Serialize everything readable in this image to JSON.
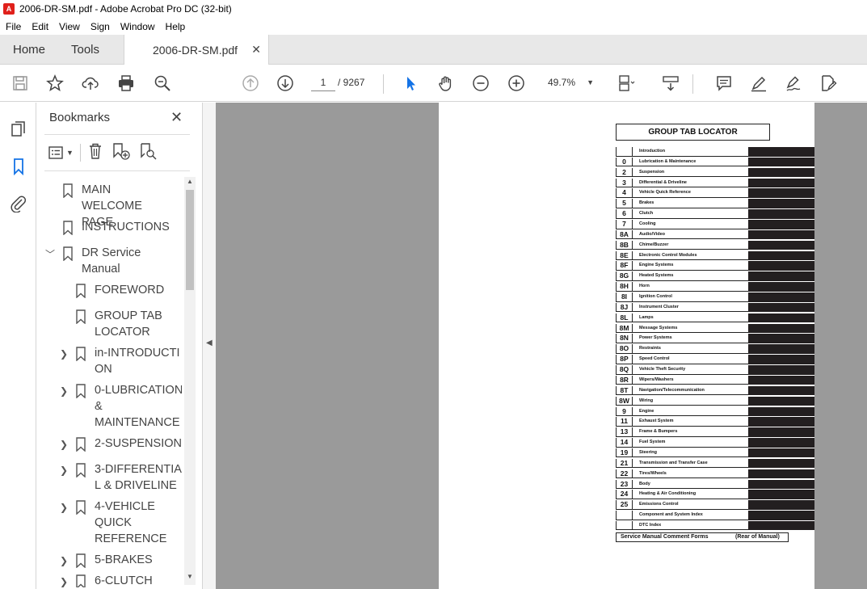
{
  "window": {
    "title": "2006-DR-SM.pdf - Adobe Acrobat Pro DC (32-bit)"
  },
  "menu": [
    "File",
    "Edit",
    "View",
    "Sign",
    "Window",
    "Help"
  ],
  "tabs": {
    "home": "Home",
    "tools": "Tools",
    "document": "2006-DR-SM.pdf"
  },
  "toolbar": {
    "page_current": "1",
    "page_total": "/ 9267",
    "zoom": "49.7%"
  },
  "bookmarks": {
    "header": "Bookmarks",
    "items": [
      {
        "label": "MAIN WELCOME\nPAGE",
        "level": 0,
        "expander": ""
      },
      {
        "label": "INSTRUCTIONS",
        "level": 0,
        "expander": ""
      },
      {
        "label": "DR Service\nManual",
        "level": 0,
        "expander": "down"
      },
      {
        "label": "FOREWORD",
        "level": 1,
        "expander": ""
      },
      {
        "label": "GROUP TAB\nLOCATOR",
        "level": 1,
        "expander": ""
      },
      {
        "label": "in-INTRODUCTI\nON",
        "level": 1,
        "expander": "right"
      },
      {
        "label": "0-LUBRICATION\n&\nMAINTENANCE",
        "level": 1,
        "expander": "right"
      },
      {
        "label": "2-SUSPENSION",
        "level": 1,
        "expander": "right"
      },
      {
        "label": "3-DIFFERENTIA\nL & DRIVELINE",
        "level": 1,
        "expander": "right"
      },
      {
        "label": "4-VEHICLE\nQUICK\nREFERENCE",
        "level": 1,
        "expander": "right"
      },
      {
        "label": "5-BRAKES",
        "level": 1,
        "expander": "right"
      },
      {
        "label": "6-CLUTCH",
        "level": 1,
        "expander": "right"
      }
    ]
  },
  "document": {
    "title": "GROUP TAB LOCATOR",
    "rows": [
      {
        "code": "",
        "name": "Introduction"
      },
      {
        "code": "0",
        "name": "Lubrication & Maintenance"
      },
      {
        "code": "2",
        "name": "Suspension"
      },
      {
        "code": "3",
        "name": "Differential & Driveline"
      },
      {
        "code": "4",
        "name": "Vehicle Quick Reference"
      },
      {
        "code": "5",
        "name": "Brakes"
      },
      {
        "code": "6",
        "name": "Clutch"
      },
      {
        "code": "7",
        "name": "Cooling"
      },
      {
        "code": "8A",
        "name": "Audio/Video"
      },
      {
        "code": "8B",
        "name": "Chime/Buzzer"
      },
      {
        "code": "8E",
        "name": "Electronic Control Modules"
      },
      {
        "code": "8F",
        "name": "Engine Systems"
      },
      {
        "code": "8G",
        "name": "Heated Systems"
      },
      {
        "code": "8H",
        "name": "Horn"
      },
      {
        "code": "8I",
        "name": "Ignition Control"
      },
      {
        "code": "8J",
        "name": "Instrument Cluster"
      },
      {
        "code": "8L",
        "name": "Lamps"
      },
      {
        "code": "8M",
        "name": "Message Systems"
      },
      {
        "code": "8N",
        "name": "Power Systems"
      },
      {
        "code": "8O",
        "name": "Restraints"
      },
      {
        "code": "8P",
        "name": "Speed Control"
      },
      {
        "code": "8Q",
        "name": "Vehicle Theft Security"
      },
      {
        "code": "8R",
        "name": "Wipers/Washers"
      },
      {
        "code": "8T",
        "name": "Navigation/Telecommunication"
      },
      {
        "code": "8W",
        "name": "Wiring"
      },
      {
        "code": "9",
        "name": "Engine"
      },
      {
        "code": "11",
        "name": "Exhaust System"
      },
      {
        "code": "13",
        "name": "Frame & Bumpers"
      },
      {
        "code": "14",
        "name": "Fuel System"
      },
      {
        "code": "19",
        "name": "Steering"
      },
      {
        "code": "21",
        "name": "Transmission and Transfer Case"
      },
      {
        "code": "22",
        "name": "Tires/Wheels"
      },
      {
        "code": "23",
        "name": "Body"
      },
      {
        "code": "24",
        "name": "Heating & Air Conditioning"
      },
      {
        "code": "25",
        "name": "Emissions Control"
      },
      {
        "code": "",
        "name": "Component and System Index"
      },
      {
        "code": "",
        "name": "DTC Index"
      }
    ],
    "footer_left": "Service Manual Comment Forms",
    "footer_right": "(Rear of Manual)"
  }
}
